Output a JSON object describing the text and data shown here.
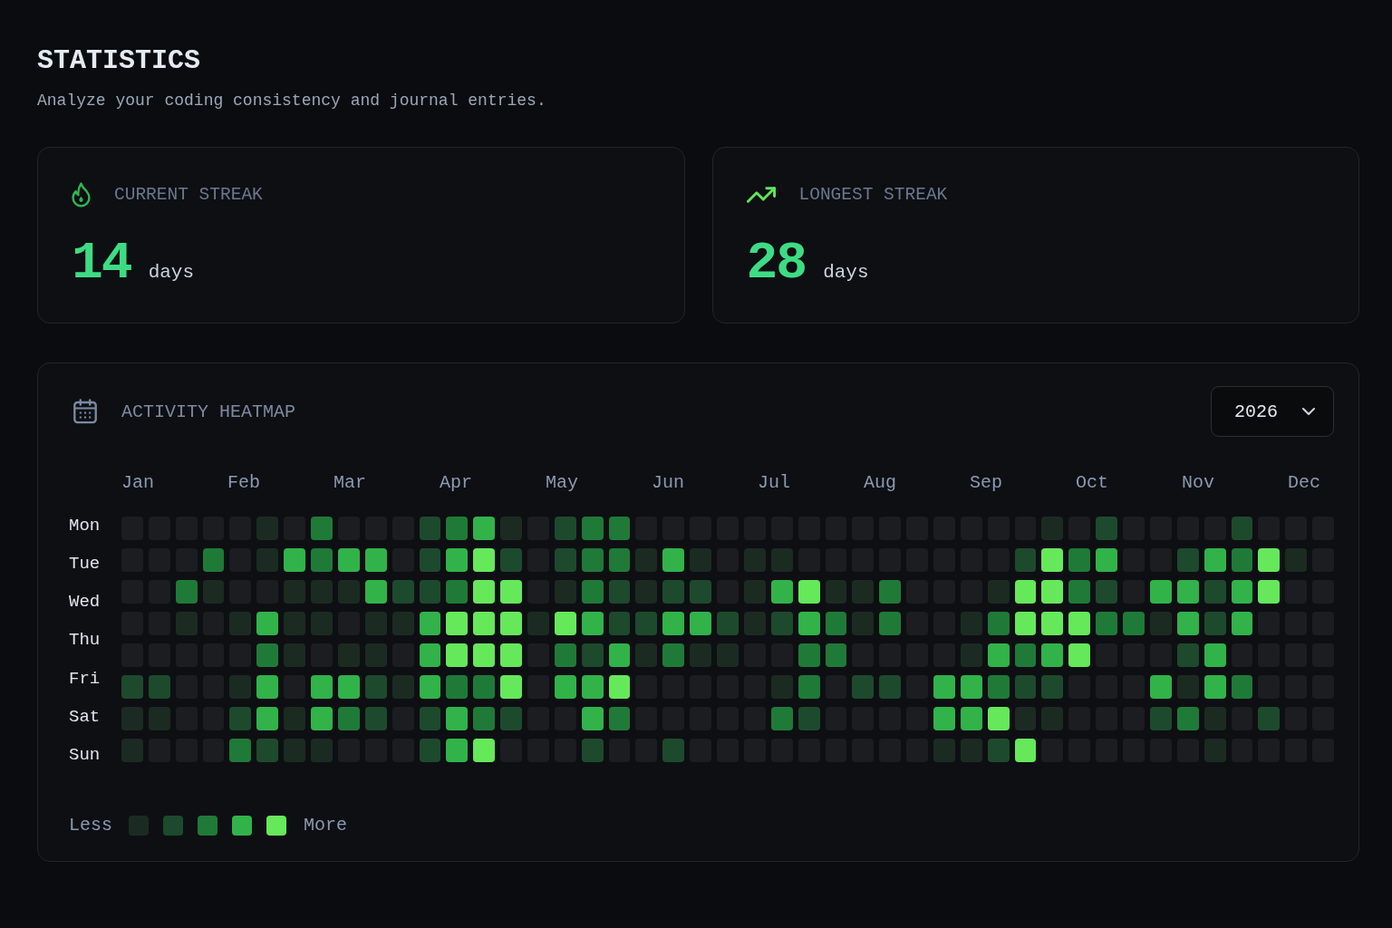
{
  "header": {
    "title": "STATISTICS",
    "subtitle": "Analyze your coding consistency and journal entries."
  },
  "stats": [
    {
      "kind": "current",
      "label": "CURRENT STREAK",
      "value": "14",
      "unit": "days"
    },
    {
      "kind": "longest",
      "label": "LONGEST STREAK",
      "value": "28",
      "unit": "days"
    }
  ],
  "heatmap": {
    "title": "ACTIVITY HEATMAP",
    "year_dropdown": {
      "value": "2026"
    },
    "months": [
      "Jan",
      "Feb",
      "Mar",
      "Apr",
      "May",
      "Jun",
      "Jul",
      "Aug",
      "Sep",
      "Oct",
      "Nov",
      "Dec"
    ],
    "day_labels": [
      "Mon",
      "Tue",
      "Wed",
      "Thu",
      "Fri",
      "Sat",
      "Sun"
    ],
    "rows": [
      {
        "cells": [
          {
            "color": "#1b1d21"
          },
          {
            "color": "#1b1d21"
          },
          {
            "color": "#1b1d21"
          },
          {
            "color": "#1b1d21"
          },
          {
            "color": "#1b1d21"
          },
          {
            "color": "#1b2b22"
          },
          {
            "color": "#1b1d21"
          },
          {
            "color": "#1f7a38"
          },
          {
            "color": "#1b1d21"
          },
          {
            "color": "#1b1d21"
          },
          {
            "color": "#1b1d21"
          },
          {
            "color": "#1d4a2c"
          },
          {
            "color": "#1f7a38"
          },
          {
            "color": "#31b34a"
          },
          {
            "color": "#1b2b22"
          },
          {
            "color": "#1b1d21"
          },
          {
            "color": "#1d4a2c"
          },
          {
            "color": "#1f7a38"
          },
          {
            "color": "#1f7a38"
          },
          {
            "color": "#1b1d21"
          },
          {
            "color": "#1b1d21"
          },
          {
            "color": "#1b1d21"
          },
          {
            "color": "#1b1d21"
          },
          {
            "color": "#1b1d21"
          },
          {
            "color": "#1b1d21"
          },
          {
            "color": "#1b1d21"
          },
          {
            "color": "#1b1d21"
          },
          {
            "color": "#1b1d21"
          },
          {
            "color": "#1b1d21"
          },
          {
            "color": "#1b1d21"
          },
          {
            "color": "#1b1d21"
          },
          {
            "color": "#1b1d21"
          },
          {
            "color": "#1b1d21"
          },
          {
            "color": "#1b1d21"
          },
          {
            "color": "#1b2b22"
          },
          {
            "color": "#1b1d21"
          },
          {
            "color": "#1d4a2c"
          },
          {
            "color": "#1b1d21"
          },
          {
            "color": "#1b1d21"
          },
          {
            "color": "#1b1d21"
          },
          {
            "color": "#1b1d21"
          },
          {
            "color": "#1d4a2c"
          },
          {
            "color": "#1b1d21"
          },
          {
            "color": "#1b1d21"
          },
          {
            "color": "#1b1d21"
          }
        ]
      },
      {
        "cells": [
          {
            "color": "#1b1d21"
          },
          {
            "color": "#1b1d21"
          },
          {
            "color": "#1b1d21"
          },
          {
            "color": "#1f7a38"
          },
          {
            "color": "#1b1d21"
          },
          {
            "color": "#1b2b22"
          },
          {
            "color": "#31b34a"
          },
          {
            "color": "#1f7a38"
          },
          {
            "color": "#31b34a"
          },
          {
            "color": "#31b34a"
          },
          {
            "color": "#1b1d21"
          },
          {
            "color": "#1d4a2c"
          },
          {
            "color": "#31b34a"
          },
          {
            "color": "#66e85b"
          },
          {
            "color": "#1d4a2c"
          },
          {
            "color": "#1b1d21"
          },
          {
            "color": "#1d4a2c"
          },
          {
            "color": "#1f7a38"
          },
          {
            "color": "#1f7a38"
          },
          {
            "color": "#1b2b22"
          },
          {
            "color": "#31b34a"
          },
          {
            "color": "#1b2b22"
          },
          {
            "color": "#1b1d21"
          },
          {
            "color": "#1b2b22"
          },
          {
            "color": "#1b2b22"
          },
          {
            "color": "#1b1d21"
          },
          {
            "color": "#1b1d21"
          },
          {
            "color": "#1b1d21"
          },
          {
            "color": "#1b1d21"
          },
          {
            "color": "#1b1d21"
          },
          {
            "color": "#1b1d21"
          },
          {
            "color": "#1b1d21"
          },
          {
            "color": "#1b1d21"
          },
          {
            "color": "#1d4a2c"
          },
          {
            "color": "#66e85b"
          },
          {
            "color": "#1f7a38"
          },
          {
            "color": "#31b34a"
          },
          {
            "color": "#1b1d21"
          },
          {
            "color": "#1b1d21"
          },
          {
            "color": "#1d4a2c"
          },
          {
            "color": "#31b34a"
          },
          {
            "color": "#1f7a38"
          },
          {
            "color": "#66e85b"
          },
          {
            "color": "#1b2b22"
          },
          {
            "color": "#1b1d21"
          }
        ]
      },
      {
        "cells": [
          {
            "color": "#1b1d21"
          },
          {
            "color": "#1b1d21"
          },
          {
            "color": "#1f7a38"
          },
          {
            "color": "#1b2b22"
          },
          {
            "color": "#1b1d21"
          },
          {
            "color": "#1b1d21"
          },
          {
            "color": "#1b2b22"
          },
          {
            "color": "#1b2b22"
          },
          {
            "color": "#1b2b22"
          },
          {
            "color": "#31b34a"
          },
          {
            "color": "#1d4a2c"
          },
          {
            "color": "#1d4a2c"
          },
          {
            "color": "#1f7a38"
          },
          {
            "color": "#66e85b"
          },
          {
            "color": "#66e85b"
          },
          {
            "color": "#1b1d21"
          },
          {
            "color": "#1b2b22"
          },
          {
            "color": "#1f7a38"
          },
          {
            "color": "#1d4a2c"
          },
          {
            "color": "#1b2b22"
          },
          {
            "color": "#1d4a2c"
          },
          {
            "color": "#1d4a2c"
          },
          {
            "color": "#1b1d21"
          },
          {
            "color": "#1b2b22"
          },
          {
            "color": "#31b34a"
          },
          {
            "color": "#66e85b"
          },
          {
            "color": "#1b2b22"
          },
          {
            "color": "#1b2b22"
          },
          {
            "color": "#1f7a38"
          },
          {
            "color": "#1b1d21"
          },
          {
            "color": "#1b1d21"
          },
          {
            "color": "#1b1d21"
          },
          {
            "color": "#1b2b22"
          },
          {
            "color": "#66e85b"
          },
          {
            "color": "#66e85b"
          },
          {
            "color": "#1f7a38"
          },
          {
            "color": "#1d4a2c"
          },
          {
            "color": "#1b1d21"
          },
          {
            "color": "#31b34a"
          },
          {
            "color": "#31b34a"
          },
          {
            "color": "#1d4a2c"
          },
          {
            "color": "#31b34a"
          },
          {
            "color": "#66e85b"
          },
          {
            "color": "#1b1d21"
          },
          {
            "color": "#1b1d21"
          }
        ]
      },
      {
        "cells": [
          {
            "color": "#1b1d21"
          },
          {
            "color": "#1b1d21"
          },
          {
            "color": "#1b2b22"
          },
          {
            "color": "#1b1d21"
          },
          {
            "color": "#1b2b22"
          },
          {
            "color": "#31b34a"
          },
          {
            "color": "#1b2b22"
          },
          {
            "color": "#1b2b22"
          },
          {
            "color": "#1b1d21"
          },
          {
            "color": "#1b2b22"
          },
          {
            "color": "#1b2b22"
          },
          {
            "color": "#31b34a"
          },
          {
            "color": "#66e85b"
          },
          {
            "color": "#66e85b"
          },
          {
            "color": "#66e85b"
          },
          {
            "color": "#1b2b22"
          },
          {
            "color": "#66e85b"
          },
          {
            "color": "#31b34a"
          },
          {
            "color": "#1d4a2c"
          },
          {
            "color": "#1d4a2c"
          },
          {
            "color": "#31b34a"
          },
          {
            "color": "#31b34a"
          },
          {
            "color": "#1d4a2c"
          },
          {
            "color": "#1b2b22"
          },
          {
            "color": "#1d4a2c"
          },
          {
            "color": "#31b34a"
          },
          {
            "color": "#1f7a38"
          },
          {
            "color": "#1b2b22"
          },
          {
            "color": "#1f7a38"
          },
          {
            "color": "#1b1d21"
          },
          {
            "color": "#1b1d21"
          },
          {
            "color": "#1b2b22"
          },
          {
            "color": "#1f7a38"
          },
          {
            "color": "#66e85b"
          },
          {
            "color": "#66e85b"
          },
          {
            "color": "#66e85b"
          },
          {
            "color": "#1f7a38"
          },
          {
            "color": "#1f7a38"
          },
          {
            "color": "#1b2b22"
          },
          {
            "color": "#31b34a"
          },
          {
            "color": "#1d4a2c"
          },
          {
            "color": "#31b34a"
          },
          {
            "color": "#1b1d21"
          },
          {
            "color": "#1b1d21"
          },
          {
            "color": "#1b1d21"
          }
        ]
      },
      {
        "cells": [
          {
            "color": "#1b1d21"
          },
          {
            "color": "#1b1d21"
          },
          {
            "color": "#1b1d21"
          },
          {
            "color": "#1b1d21"
          },
          {
            "color": "#1b1d21"
          },
          {
            "color": "#1f7a38"
          },
          {
            "color": "#1b2b22"
          },
          {
            "color": "#1b1d21"
          },
          {
            "color": "#1b2b22"
          },
          {
            "color": "#1b2b22"
          },
          {
            "color": "#1b1d21"
          },
          {
            "color": "#31b34a"
          },
          {
            "color": "#66e85b"
          },
          {
            "color": "#66e85b"
          },
          {
            "color": "#66e85b"
          },
          {
            "color": "#1b1d21"
          },
          {
            "color": "#1f7a38"
          },
          {
            "color": "#1d4a2c"
          },
          {
            "color": "#31b34a"
          },
          {
            "color": "#1b2b22"
          },
          {
            "color": "#1f7a38"
          },
          {
            "color": "#1b2b22"
          },
          {
            "color": "#1b2b22"
          },
          {
            "color": "#1b1d21"
          },
          {
            "color": "#1b1d21"
          },
          {
            "color": "#1f7a38"
          },
          {
            "color": "#1f7a38"
          },
          {
            "color": "#1b1d21"
          },
          {
            "color": "#1b1d21"
          },
          {
            "color": "#1b1d21"
          },
          {
            "color": "#1b1d21"
          },
          {
            "color": "#1b2b22"
          },
          {
            "color": "#31b34a"
          },
          {
            "color": "#1f7a38"
          },
          {
            "color": "#31b34a"
          },
          {
            "color": "#66e85b"
          },
          {
            "color": "#1b1d21"
          },
          {
            "color": "#1b1d21"
          },
          {
            "color": "#1b1d21"
          },
          {
            "color": "#1d4a2c"
          },
          {
            "color": "#31b34a"
          },
          {
            "color": "#1b1d21"
          },
          {
            "color": "#1b1d21"
          },
          {
            "color": "#1b1d21"
          },
          {
            "color": "#1b1d21"
          }
        ]
      },
      {
        "cells": [
          {
            "color": "#1d4a2c"
          },
          {
            "color": "#1d4a2c"
          },
          {
            "color": "#1b1d21"
          },
          {
            "color": "#1b1d21"
          },
          {
            "color": "#1b2b22"
          },
          {
            "color": "#31b34a"
          },
          {
            "color": "#1b1d21"
          },
          {
            "color": "#31b34a"
          },
          {
            "color": "#31b34a"
          },
          {
            "color": "#1d4a2c"
          },
          {
            "color": "#1b2b22"
          },
          {
            "color": "#31b34a"
          },
          {
            "color": "#1f7a38"
          },
          {
            "color": "#1f7a38"
          },
          {
            "color": "#66e85b"
          },
          {
            "color": "#1b1d21"
          },
          {
            "color": "#31b34a"
          },
          {
            "color": "#31b34a"
          },
          {
            "color": "#66e85b"
          },
          {
            "color": "#1b1d21"
          },
          {
            "color": "#1b1d21"
          },
          {
            "color": "#1b1d21"
          },
          {
            "color": "#1b1d21"
          },
          {
            "color": "#1b1d21"
          },
          {
            "color": "#1b2b22"
          },
          {
            "color": "#1f7a38"
          },
          {
            "color": "#1b1d21"
          },
          {
            "color": "#1d4a2c"
          },
          {
            "color": "#1d4a2c"
          },
          {
            "color": "#1b1d21"
          },
          {
            "color": "#31b34a"
          },
          {
            "color": "#31b34a"
          },
          {
            "color": "#1f7a38"
          },
          {
            "color": "#1d4a2c"
          },
          {
            "color": "#1d4a2c"
          },
          {
            "color": "#1b1d21"
          },
          {
            "color": "#1b1d21"
          },
          {
            "color": "#1b1d21"
          },
          {
            "color": "#31b34a"
          },
          {
            "color": "#1b2b22"
          },
          {
            "color": "#31b34a"
          },
          {
            "color": "#1f7a38"
          },
          {
            "color": "#1b1d21"
          },
          {
            "color": "#1b1d21"
          },
          {
            "color": "#1b1d21"
          }
        ]
      },
      {
        "cells": [
          {
            "color": "#1b2b22"
          },
          {
            "color": "#1b2b22"
          },
          {
            "color": "#1b1d21"
          },
          {
            "color": "#1b1d21"
          },
          {
            "color": "#1d4a2c"
          },
          {
            "color": "#31b34a"
          },
          {
            "color": "#1b2b22"
          },
          {
            "color": "#31b34a"
          },
          {
            "color": "#1f7a38"
          },
          {
            "color": "#1d4a2c"
          },
          {
            "color": "#1b1d21"
          },
          {
            "color": "#1d4a2c"
          },
          {
            "color": "#31b34a"
          },
          {
            "color": "#1f7a38"
          },
          {
            "color": "#1d4a2c"
          },
          {
            "color": "#1b1d21"
          },
          {
            "color": "#1b1d21"
          },
          {
            "color": "#31b34a"
          },
          {
            "color": "#1f7a38"
          },
          {
            "color": "#1b1d21"
          },
          {
            "color": "#1b1d21"
          },
          {
            "color": "#1b1d21"
          },
          {
            "color": "#1b1d21"
          },
          {
            "color": "#1b1d21"
          },
          {
            "color": "#1f7a38"
          },
          {
            "color": "#1d4a2c"
          },
          {
            "color": "#1b1d21"
          },
          {
            "color": "#1b1d21"
          },
          {
            "color": "#1b1d21"
          },
          {
            "color": "#1b1d21"
          },
          {
            "color": "#31b34a"
          },
          {
            "color": "#31b34a"
          },
          {
            "color": "#66e85b"
          },
          {
            "color": "#1b2b22"
          },
          {
            "color": "#1b2b22"
          },
          {
            "color": "#1b1d21"
          },
          {
            "color": "#1b1d21"
          },
          {
            "color": "#1b1d21"
          },
          {
            "color": "#1d4a2c"
          },
          {
            "color": "#1f7a38"
          },
          {
            "color": "#1b2b22"
          },
          {
            "color": "#1b1d21"
          },
          {
            "color": "#1d4a2c"
          },
          {
            "color": "#1b1d21"
          },
          {
            "color": "#1b1d21"
          }
        ]
      },
      {
        "cells": [
          {
            "color": "#1b2b22"
          },
          {
            "color": "#1b1d21"
          },
          {
            "color": "#1b1d21"
          },
          {
            "color": "#1b1d21"
          },
          {
            "color": "#1f7a38"
          },
          {
            "color": "#1d4a2c"
          },
          {
            "color": "#1b2b22"
          },
          {
            "color": "#1b2b22"
          },
          {
            "color": "#1b1d21"
          },
          {
            "color": "#1b1d21"
          },
          {
            "color": "#1b1d21"
          },
          {
            "color": "#1d4a2c"
          },
          {
            "color": "#31b34a"
          },
          {
            "color": "#66e85b"
          },
          {
            "color": "#1b1d21"
          },
          {
            "color": "#1b1d21"
          },
          {
            "color": "#1b1d21"
          },
          {
            "color": "#1d4a2c"
          },
          {
            "color": "#1b1d21"
          },
          {
            "color": "#1b1d21"
          },
          {
            "color": "#1d4a2c"
          },
          {
            "color": "#1b1d21"
          },
          {
            "color": "#1b1d21"
          },
          {
            "color": "#1b1d21"
          },
          {
            "color": "#1b1d21"
          },
          {
            "color": "#1b1d21"
          },
          {
            "color": "#1b1d21"
          },
          {
            "color": "#1b1d21"
          },
          {
            "color": "#1b1d21"
          },
          {
            "color": "#1b1d21"
          },
          {
            "color": "#1b2b22"
          },
          {
            "color": "#1b2b22"
          },
          {
            "color": "#1d4a2c"
          },
          {
            "color": "#66e85b"
          },
          {
            "color": "#1b1d21"
          },
          {
            "color": "#1b1d21"
          },
          {
            "color": "#1b1d21"
          },
          {
            "color": "#1b1d21"
          },
          {
            "color": "#1b1d21"
          },
          {
            "color": "#1b1d21"
          },
          {
            "color": "#1b2b22"
          },
          {
            "color": "#1b1d21"
          },
          {
            "color": "#1b1d21"
          },
          {
            "color": "#1b1d21"
          },
          {
            "color": "#1b1d21"
          }
        ]
      }
    ],
    "legend": {
      "less_label": "Less",
      "swatches": [
        {
          "color": "#1b2b22"
        },
        {
          "color": "#1d4a2c"
        },
        {
          "color": "#1f7a38"
        },
        {
          "color": "#31b34a"
        },
        {
          "color": "#66e85b"
        }
      ],
      "more_label": "More"
    }
  }
}
